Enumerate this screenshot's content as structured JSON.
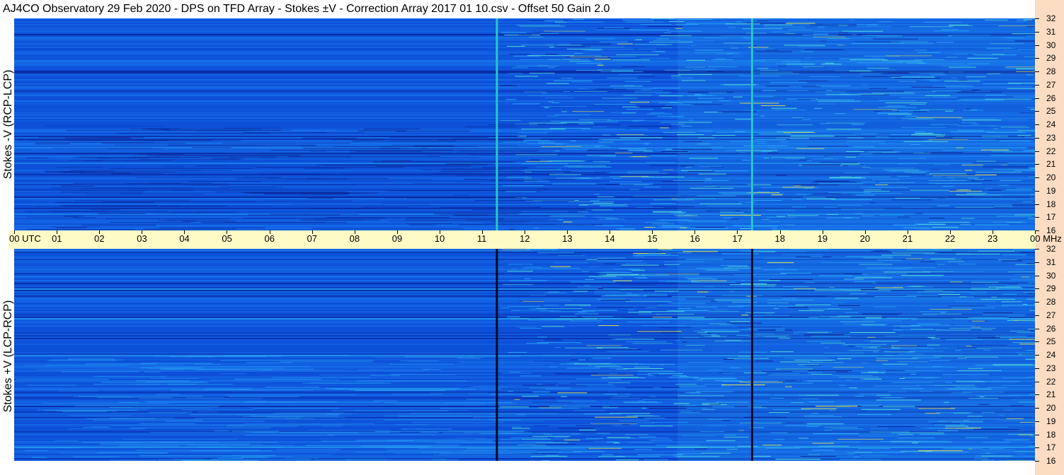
{
  "title": "AJ4CO Observatory  29 Feb 2020  -  DPS on TFD Array  -  Stokes ±V  -  Correction Array 2017 01 10.csv  -  Offset 50  Gain 2.0",
  "chart_data": [
    {
      "type": "heatmap",
      "panel": "top",
      "ylabel": "Stokes -V (RCP-LCP)",
      "ylim": [
        16,
        32
      ],
      "y_unit": "MHz",
      "x_unit": "UTC",
      "xlim": [
        0,
        24
      ],
      "x_ticks": [
        "00",
        "01",
        "02",
        "03",
        "04",
        "05",
        "06",
        "07",
        "08",
        "09",
        "10",
        "11",
        "12",
        "13",
        "14",
        "15",
        "16",
        "17",
        "18",
        "19",
        "20",
        "21",
        "22",
        "23",
        "00"
      ],
      "y_ticks": [
        "16",
        "17",
        "18",
        "19",
        "20",
        "21",
        "22",
        "23",
        "24",
        "25",
        "26",
        "27",
        "28",
        "29",
        "30",
        "31",
        "32"
      ],
      "vertical_lines_utc": [
        11.35,
        17.35
      ],
      "vertical_line_color": "#27c7c7",
      "colormap": [
        "#0a1f8f",
        "#0d50d8",
        "#1a78ef",
        "#2aaaf5",
        "#54e0d8",
        "#e2e85a"
      ]
    },
    {
      "type": "heatmap",
      "panel": "bottom",
      "ylabel": "Stokes +V (LCP-RCP)",
      "ylim": [
        16,
        32
      ],
      "y_unit": "MHz",
      "x_unit": "UTC",
      "xlim": [
        0,
        24
      ],
      "x_ticks": [
        "00",
        "01",
        "02",
        "03",
        "04",
        "05",
        "06",
        "07",
        "08",
        "09",
        "10",
        "11",
        "12",
        "13",
        "14",
        "15",
        "16",
        "17",
        "18",
        "19",
        "20",
        "21",
        "22",
        "23",
        "00"
      ],
      "y_ticks": [
        "16",
        "17",
        "18",
        "19",
        "20",
        "21",
        "22",
        "23",
        "24",
        "25",
        "26",
        "27",
        "28",
        "29",
        "30",
        "31",
        "32"
      ],
      "vertical_lines_utc": [
        11.35,
        17.35
      ],
      "vertical_line_color": "#050a20",
      "colormap": [
        "#0a1f8f",
        "#0d50d8",
        "#1a78ef",
        "#2aaaf5",
        "#54e0d8",
        "#e2e85a"
      ]
    }
  ],
  "time_axis": {
    "labels": [
      "00",
      "01",
      "02",
      "03",
      "04",
      "05",
      "06",
      "07",
      "08",
      "09",
      "10",
      "11",
      "12",
      "13",
      "14",
      "15",
      "16",
      "17",
      "18",
      "19",
      "20",
      "21",
      "22",
      "23",
      "00"
    ],
    "utc_label": "UTC",
    "mhz_label": "MHz"
  }
}
